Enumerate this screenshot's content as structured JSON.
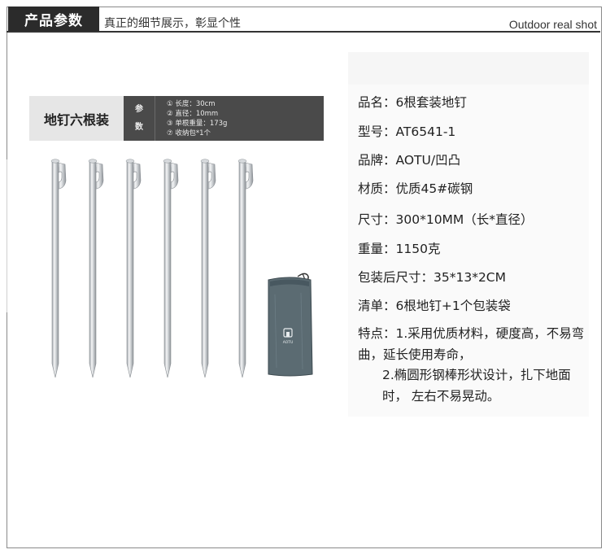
{
  "header": {
    "title": "产品参数",
    "subtitle": "真正的细节展示，彰显个性",
    "english": "Outdoor real shot"
  },
  "banner": {
    "title": "地钉六根装",
    "label_top": "参",
    "label_bottom": "数",
    "specs": [
      "①  长度：30cm",
      "②  直径：10mm",
      "③  单根重量：173g",
      "⑦  收纳包*1个"
    ]
  },
  "bag": {
    "brand": "AOTU"
  },
  "product": {
    "name": "品名：6根套装地钉",
    "model": "型号：AT6541-1",
    "brand": "品牌：AOTU/凹凸",
    "material": "材质：优质45#碳钢",
    "size": "尺寸：300*10MM（长*直径）",
    "weight": "重量：1150克",
    "package_size": "包装后尺寸：35*13*2CM",
    "list": "清单：6根地钉+1个包装袋",
    "features_1": "特点：1.采用优质材料，硬度高，不易弯曲，延长使用寿命，",
    "features_2": "2.椭圆形钢棒形状设计，扎下地面时， 左右不易晃动。"
  },
  "colors": {
    "header_bg": "#2b2b2b",
    "banner_dark": "#4a4a4a",
    "bag": "#5b6b72"
  }
}
